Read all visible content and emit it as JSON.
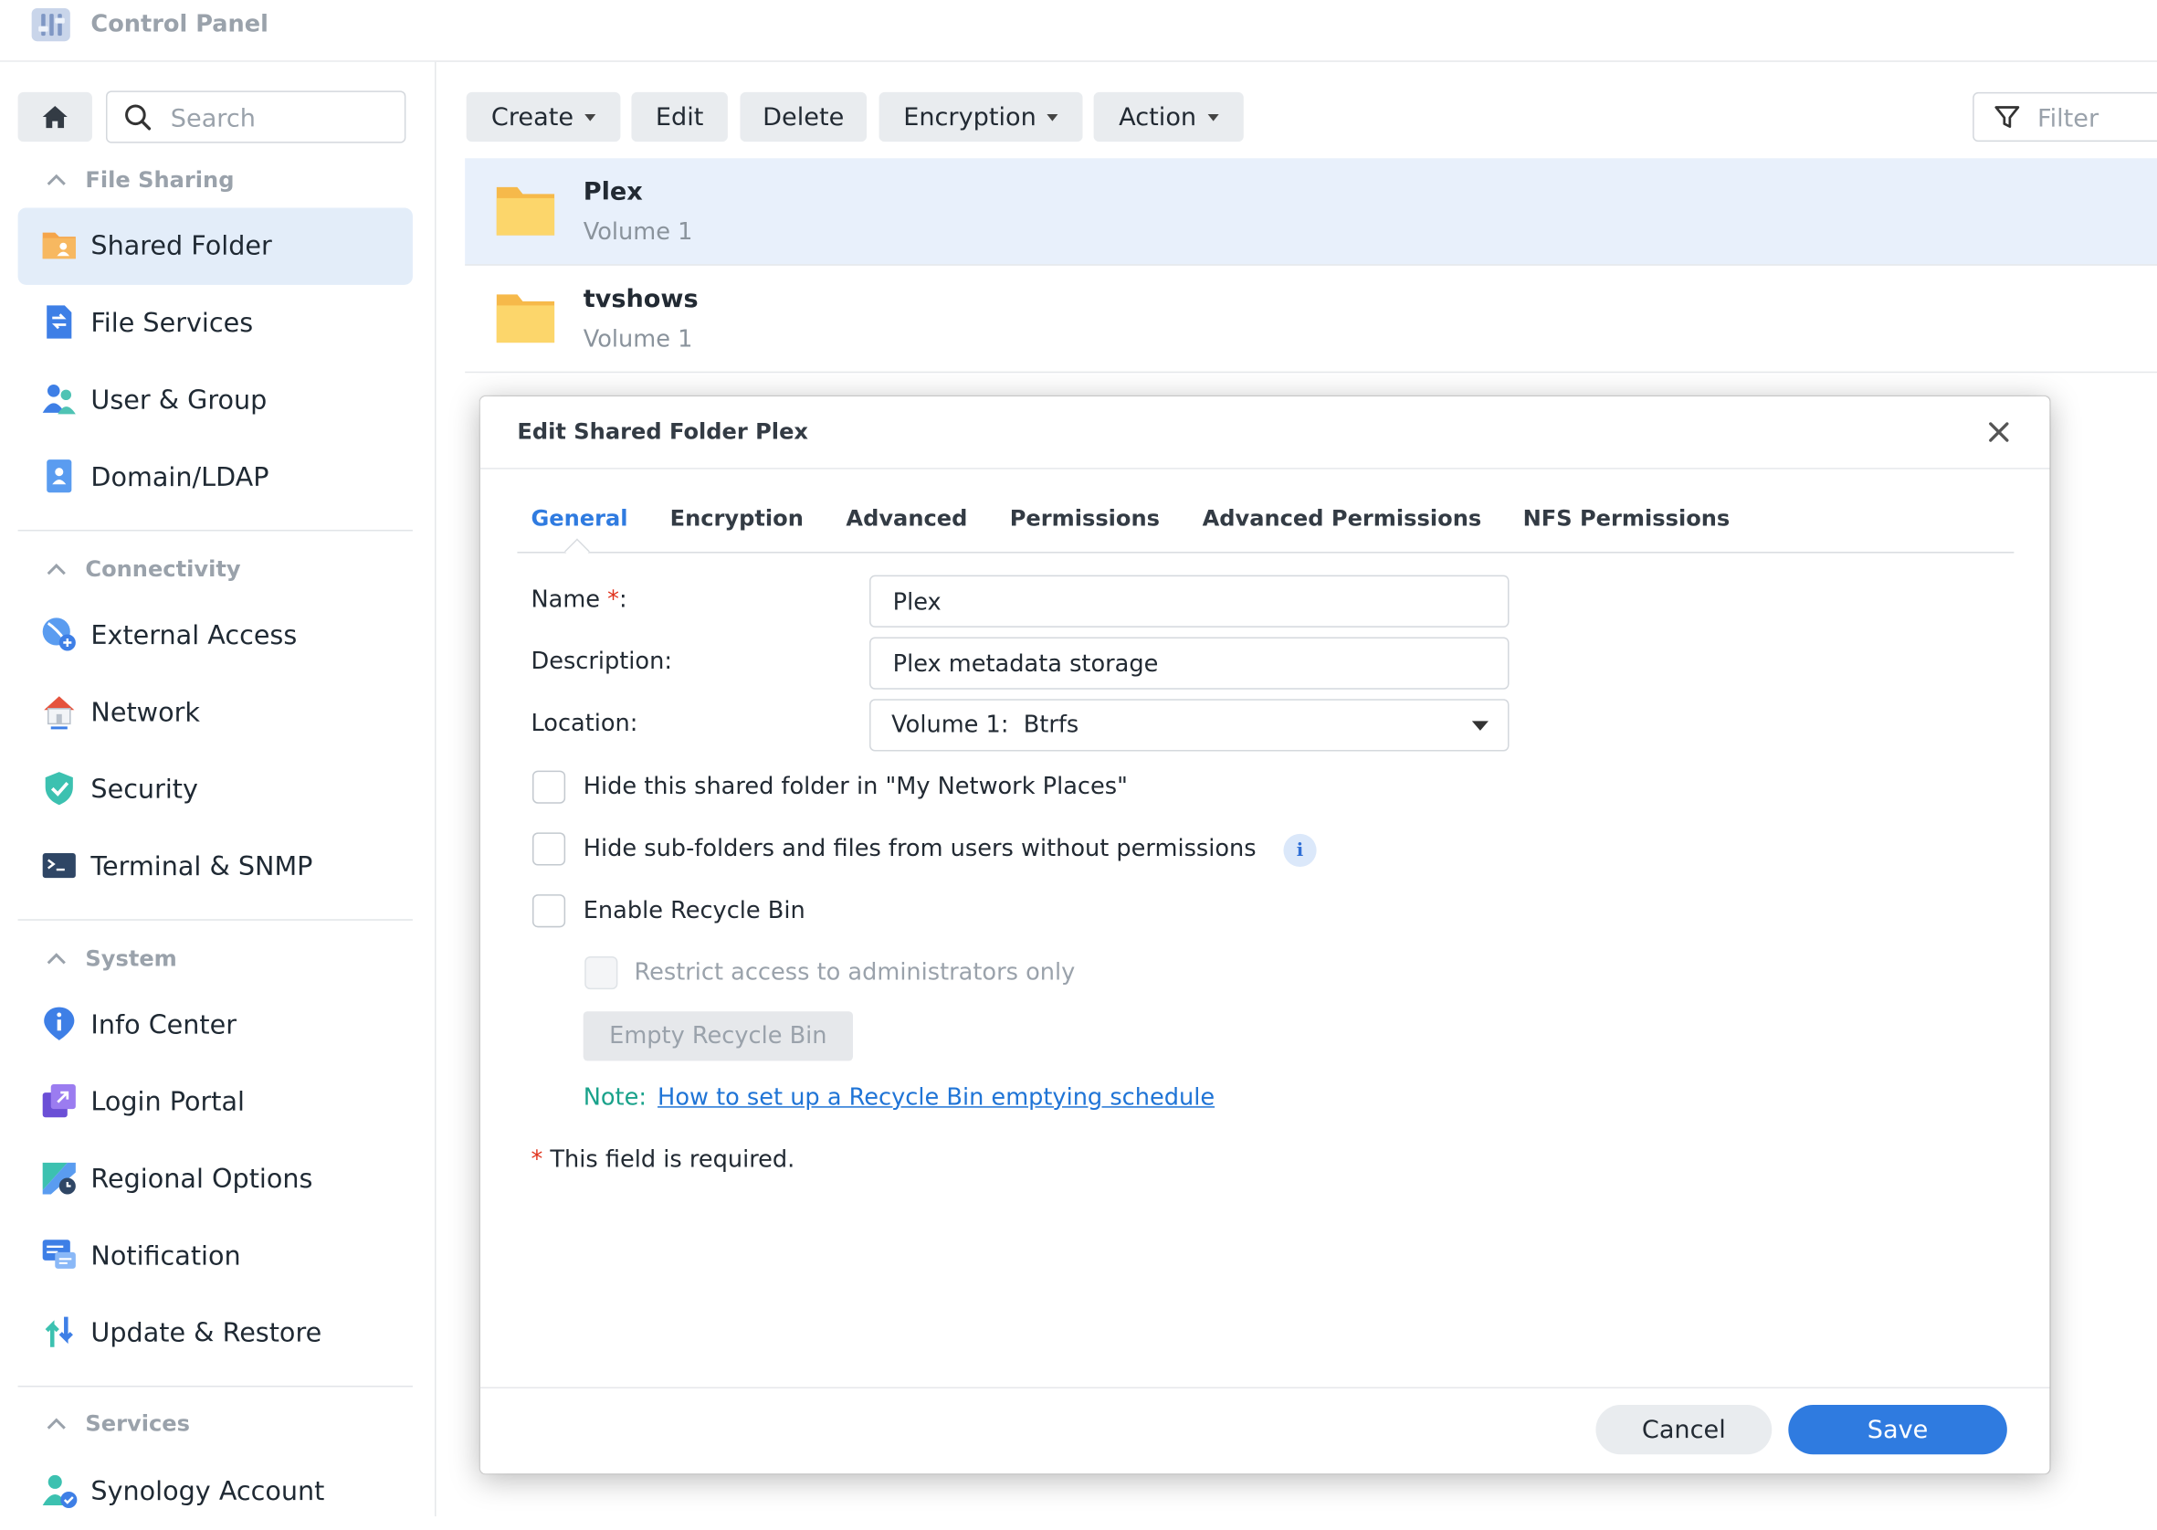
{
  "window": {
    "title": "Control Panel"
  },
  "sidebar": {
    "search_placeholder": "Search",
    "sections": [
      {
        "title": "File Sharing",
        "items": [
          {
            "label": "Shared Folder",
            "icon": "shared-folder-icon",
            "active": true
          },
          {
            "label": "File Services",
            "icon": "file-services-icon"
          },
          {
            "label": "User & Group",
            "icon": "user-group-icon"
          },
          {
            "label": "Domain/LDAP",
            "icon": "domain-ldap-icon"
          }
        ]
      },
      {
        "title": "Connectivity",
        "items": [
          {
            "label": "External Access",
            "icon": "external-access-icon"
          },
          {
            "label": "Network",
            "icon": "network-icon"
          },
          {
            "label": "Security",
            "icon": "security-shield-icon"
          },
          {
            "label": "Terminal & SNMP",
            "icon": "terminal-icon"
          }
        ]
      },
      {
        "title": "System",
        "items": [
          {
            "label": "Info Center",
            "icon": "info-center-icon"
          },
          {
            "label": "Login Portal",
            "icon": "login-portal-icon"
          },
          {
            "label": "Regional Options",
            "icon": "regional-options-icon"
          },
          {
            "label": "Notification",
            "icon": "notification-icon"
          },
          {
            "label": "Update & Restore",
            "icon": "update-restore-icon"
          }
        ]
      },
      {
        "title": "Services",
        "items": [
          {
            "label": "Synology Account",
            "icon": "synology-account-icon"
          }
        ]
      }
    ]
  },
  "toolbar": {
    "create": "Create",
    "edit": "Edit",
    "delete": "Delete",
    "encryption": "Encryption",
    "action": "Action",
    "filter_placeholder": "Filter"
  },
  "folders": [
    {
      "name": "Plex",
      "volume": "Volume 1",
      "selected": true
    },
    {
      "name": "tvshows",
      "volume": "Volume 1",
      "selected": false
    }
  ],
  "dialog": {
    "title": "Edit Shared Folder Plex",
    "tabs": [
      "General",
      "Encryption",
      "Advanced",
      "Permissions",
      "Advanced Permissions",
      "NFS Permissions"
    ],
    "active_tab": "General",
    "fields": {
      "name_label": "Name",
      "name_required_mark": "*",
      "name_colon": ":",
      "name_value": "Plex",
      "description_label": "Description:",
      "description_value": "Plex metadata storage",
      "location_label": "Location:",
      "location_value": "Volume 1:  Btrfs"
    },
    "options": {
      "hide_network_places": {
        "label": "Hide this shared folder in \"My Network Places\"",
        "checked": false
      },
      "hide_subfolders": {
        "label": "Hide sub-folders and files from users without permissions",
        "checked": false
      },
      "enable_recycle_bin": {
        "label": "Enable Recycle Bin",
        "checked": false
      },
      "restrict_admin": {
        "label": "Restrict access to administrators only",
        "checked": false,
        "disabled": true
      }
    },
    "info_glyph": "i",
    "empty_recycle_bin": "Empty Recycle Bin",
    "note_label": "Note:",
    "note_link": "How to set up a Recycle Bin emptying schedule",
    "required_mark": "*",
    "required_note": "This field is required.",
    "cancel": "Cancel",
    "save": "Save"
  },
  "colors": {
    "accent": "#2f7be0",
    "selected_row": "#e8f0fb",
    "sidebar_active": "#e3edf9",
    "note": "#1aa28b",
    "required": "#e0321c"
  }
}
